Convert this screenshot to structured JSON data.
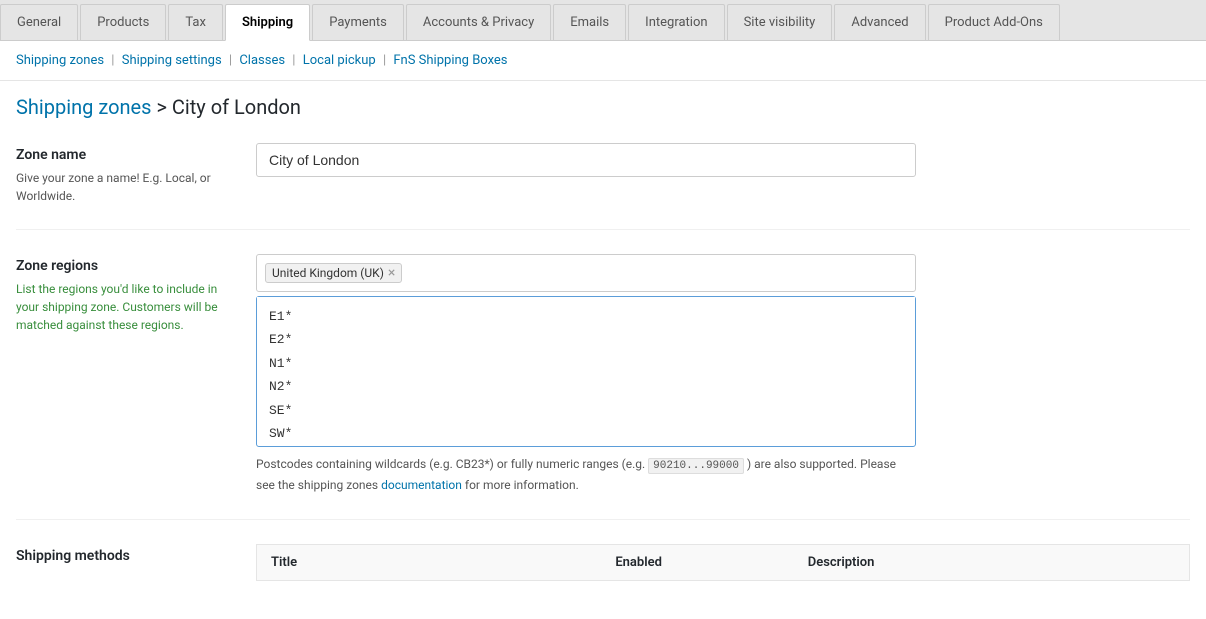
{
  "tabs": [
    {
      "label": "General",
      "active": false
    },
    {
      "label": "Products",
      "active": false
    },
    {
      "label": "Tax",
      "active": false
    },
    {
      "label": "Shipping",
      "active": true
    },
    {
      "label": "Payments",
      "active": false
    },
    {
      "label": "Accounts & Privacy",
      "active": false
    },
    {
      "label": "Emails",
      "active": false
    },
    {
      "label": "Integration",
      "active": false
    },
    {
      "label": "Site visibility",
      "active": false
    },
    {
      "label": "Advanced",
      "active": false
    },
    {
      "label": "Product Add-Ons",
      "active": false
    }
  ],
  "sub_nav": {
    "items": [
      {
        "label": "Shipping zones",
        "active": true,
        "link": true
      },
      {
        "label": "Shipping settings",
        "active": false,
        "link": true
      },
      {
        "label": "Classes",
        "active": false,
        "link": true
      },
      {
        "label": "Local pickup",
        "active": false,
        "link": true
      },
      {
        "label": "FnS Shipping Boxes",
        "active": false,
        "link": true
      }
    ]
  },
  "breadcrumb": {
    "link_text": "Shipping zones",
    "separator": ">",
    "current": "City of London"
  },
  "zone_name": {
    "label": "Zone name",
    "help": "Give your zone a name! E.g. Local, or Worldwide.",
    "value": "City of London",
    "placeholder": "Zone name"
  },
  "zone_regions": {
    "label": "Zone regions",
    "help": "List the regions you'd like to include in your shipping zone. Customers will be matched against these regions.",
    "tag": "United Kingdom (UK)",
    "postcodes": "E1*\nE2*\nN1*\nN2*\nSE*\nSW*",
    "postcode_help_before": "Postcodes containing wildcards (e.g. CB23*) or fully numeric ranges (e.g.",
    "postcode_code": "90210...99000",
    "postcode_help_after": ") are also supported. Please see the shipping zones",
    "postcode_link": "documentation",
    "postcode_help_end": "for more information."
  },
  "shipping_methods": {
    "label": "Shipping methods",
    "columns": [
      "Title",
      "Enabled",
      "Description"
    ]
  }
}
